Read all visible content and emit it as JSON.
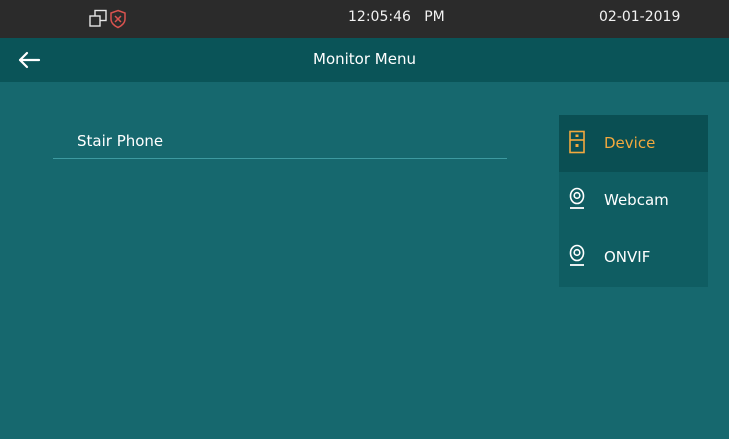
{
  "status_bar": {
    "icons": [
      "windows-icon",
      "shield-x-icon"
    ],
    "time": "12:05:46   PM",
    "date": "02-01-2019"
  },
  "header": {
    "back_icon": "back-arrow-icon",
    "title": "Monitor Menu"
  },
  "list": {
    "items": [
      {
        "label": "Stair Phone"
      }
    ]
  },
  "side_menu": {
    "items": [
      {
        "label": "Device",
        "icon": "device-icon",
        "active": true
      },
      {
        "label": "Webcam",
        "icon": "webcam-icon",
        "active": false
      },
      {
        "label": "ONVIF",
        "icon": "webcam-icon",
        "active": false
      }
    ]
  },
  "colors": {
    "background": "#16686e",
    "status_bar": "#2b2b2b",
    "header_bar": "#0a5458",
    "side_menu": "#0f5d62",
    "active_item_bg": "#0a4f53",
    "accent": "#f3a93e",
    "alert_icon": "#d9534f"
  }
}
